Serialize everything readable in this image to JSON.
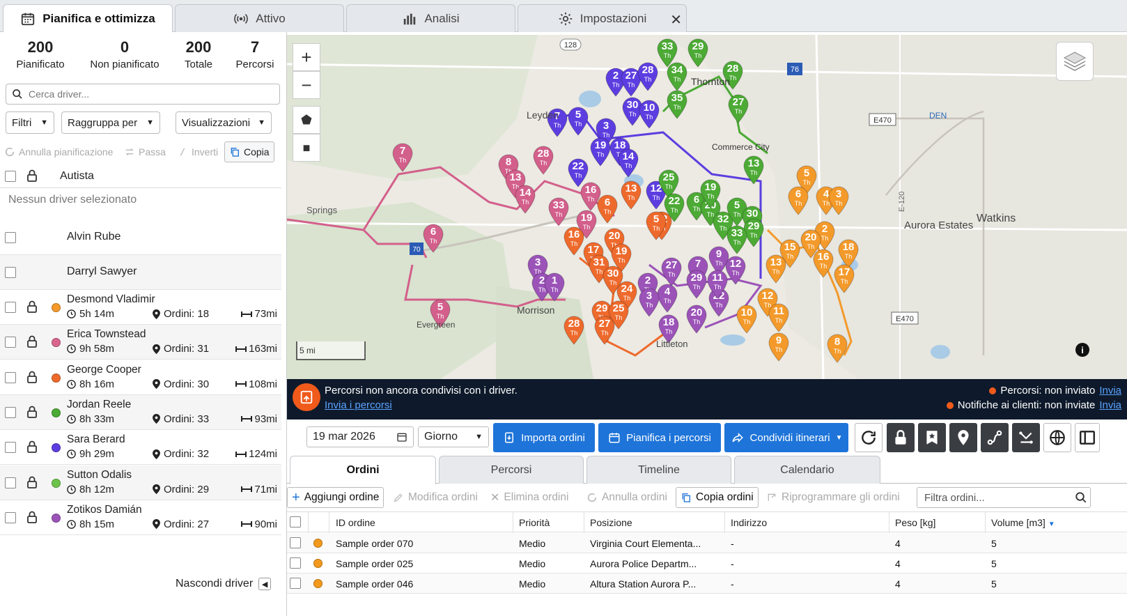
{
  "tabs": [
    {
      "label": "Pianifica e ottimizza",
      "icon": "calendar-icon"
    },
    {
      "label": "Attivo",
      "icon": "broadcast-icon"
    },
    {
      "label": "Analisi",
      "icon": "bar-chart-icon"
    },
    {
      "label": "Impostazioni",
      "icon": "gear-icon"
    }
  ],
  "stats": [
    {
      "value": "200",
      "label": "Pianificato"
    },
    {
      "value": "0",
      "label": "Non pianificato"
    },
    {
      "value": "200",
      "label": "Totale"
    },
    {
      "value": "7",
      "label": "Percorsi"
    }
  ],
  "search": {
    "placeholder": "Cerca driver..."
  },
  "filters": {
    "filtri": "Filtri",
    "raggruppa": "Raggruppa per",
    "visualizzazioni": "Visualizzazioni"
  },
  "actions": {
    "annulla": "Annulla pianificazione",
    "passa": "Passa",
    "inverti": "Inverti",
    "copia": "Copia"
  },
  "driver_header": "Autista",
  "no_driver": "Nessun driver selezionato",
  "unassigned_drivers": [
    "Alvin Rube",
    "Darryl Sawyer"
  ],
  "drivers": [
    {
      "name": "Desmond Vladimir",
      "time": "5h 14m",
      "orders": "Ordini: 18",
      "dist": "73mi",
      "color": "#f39a2b"
    },
    {
      "name": "Erica Townstead",
      "time": "9h 58m",
      "orders": "Ordini: 31",
      "dist": "163mi",
      "color": "#d9658f"
    },
    {
      "name": "George Cooper",
      "time": "8h 16m",
      "orders": "Ordini: 30",
      "dist": "108mi",
      "color": "#ee6a2c"
    },
    {
      "name": "Jordan Reele",
      "time": "8h 33m",
      "orders": "Ordini: 33",
      "dist": "93mi",
      "color": "#4caa35"
    },
    {
      "name": "Sara Berard",
      "time": "9h 29m",
      "orders": "Ordini: 32",
      "dist": "124mi",
      "color": "#5c3ee0"
    },
    {
      "name": "Sutton Odalis",
      "time": "8h 12m",
      "orders": "Ordini: 29",
      "dist": "71mi",
      "color": "#6cc34a"
    },
    {
      "name": "Zotikos Damián",
      "time": "8h 15m",
      "orders": "Ordini: 27",
      "dist": "90mi",
      "color": "#9b53b8"
    }
  ],
  "hide_drivers": "Nascondi driver",
  "map": {
    "places": [
      "Thornton",
      "Commerce City",
      "Watkins",
      "Aurora Estates",
      "Springs",
      "Morrison",
      "Evergreen",
      "Leyden",
      "Littleton",
      "DEN"
    ],
    "highways": [
      "128",
      "76",
      "E470",
      "E470",
      "70",
      "E-120"
    ],
    "scale": "5 mi"
  },
  "notice": {
    "line1": "Percorsi non ancora condivisi con i driver.",
    "link": "Invia i percorsi",
    "status1": "Percorsi: non inviato",
    "status2": "Notifiche ai clienti: non inviate",
    "action1": "Invia",
    "action2": "Invia"
  },
  "toolbar": {
    "date": "19 mar 2026",
    "period": "Giorno",
    "import": "Importa ordini",
    "plan": "Pianifica i percorsi",
    "share": "Condividi itinerari"
  },
  "panel_tabs": [
    "Ordini",
    "Percorsi",
    "Timeline",
    "Calendario"
  ],
  "order_actions": {
    "add": "Aggiungi ordine",
    "edit": "Modifica ordini",
    "delete": "Elimina ordini",
    "cancel": "Annulla ordini",
    "copy": "Copia ordini",
    "reschedule": "Riprogrammare gli ordini",
    "filter_placeholder": "Filtra ordini..."
  },
  "table": {
    "columns": [
      "ID ordine",
      "Priorità",
      "Posizione",
      "Indirizzo",
      "Peso [kg]",
      "Volume [m3]"
    ],
    "rows": [
      [
        "Sample order 070",
        "Medio",
        "Virginia Court Elementa...",
        "-",
        "4",
        "5"
      ],
      [
        "Sample order 025",
        "Medio",
        "Aurora Police Departm...",
        "-",
        "4",
        "5"
      ],
      [
        "Sample order 046",
        "Medio",
        "Altura Station Aurora P...",
        "-",
        "4",
        "5"
      ]
    ]
  }
}
